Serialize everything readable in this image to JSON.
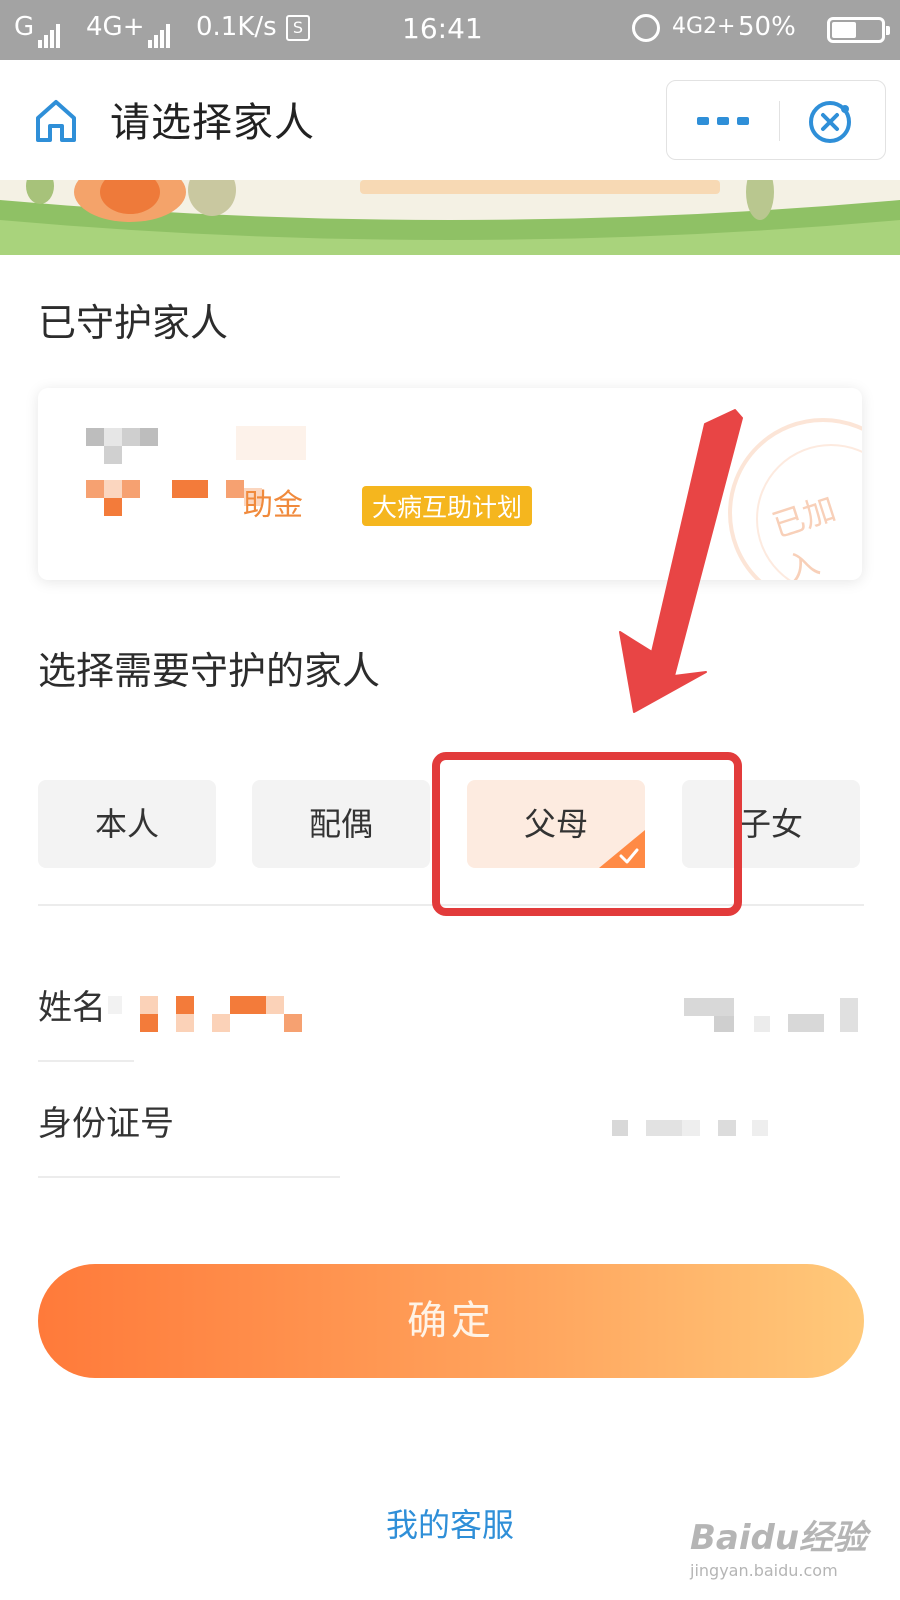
{
  "status_bar": {
    "carrier1": "G",
    "carrier2": "4G+",
    "speed": "0.1K/s",
    "time": "16:41",
    "network": "4G2+",
    "battery": "50%",
    "battery_level": 0.5
  },
  "nav": {
    "title": "请选择家人",
    "home_icon": "home-icon",
    "more_icon": "more-icon",
    "close_icon": "close-icon"
  },
  "guarded_section": {
    "title": "已守护家人",
    "card": {
      "fund_suffix": "助金",
      "plan_tag": "大病互助计划",
      "stamp_text": "已加入"
    }
  },
  "select_section": {
    "title": "选择需要守护的家人",
    "options": [
      {
        "label": "本人",
        "selected": false
      },
      {
        "label": "配偶",
        "selected": false
      },
      {
        "label": "父母",
        "selected": true
      },
      {
        "label": "子女",
        "selected": false
      }
    ]
  },
  "form": {
    "name_label": "姓名",
    "id_label": "身份证号"
  },
  "confirm_label": "确定",
  "service_link": "我的客服",
  "watermark": {
    "main": "Baidu经验",
    "sub": "jingyan.baidu.com"
  },
  "colors": {
    "accent": "#ff8a45",
    "link": "#2f8fd8",
    "tag": "#f5b61e",
    "annotation": "#e23b3b"
  }
}
